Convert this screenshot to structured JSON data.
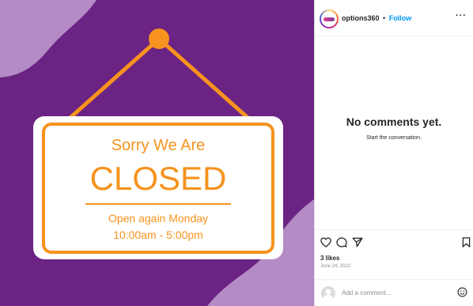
{
  "post": {
    "username": "options360",
    "separator": "•",
    "follow_label": "Follow",
    "more_label": "···"
  },
  "sign": {
    "line1": "Sorry We Are",
    "line2": "CLOSED",
    "line3": "Open again Monday",
    "line4": "10:00am - 5:00pm"
  },
  "comments": {
    "empty_title": "No comments yet.",
    "empty_subtitle": "Start the conversation."
  },
  "engagement": {
    "likes": "3 likes",
    "date": "June 24, 2022"
  },
  "comment_box": {
    "placeholder": "Add a comment..."
  },
  "colors": {
    "background_purple": "#6b2384",
    "blob_lavender": "#b48bc5",
    "sign_orange": "#f7931e",
    "follow_blue": "#0095f6"
  },
  "icons": {
    "like": "heart-icon",
    "comment": "comment-icon",
    "share": "paper-plane-icon",
    "save": "bookmark-icon",
    "emoji": "smiley-icon",
    "more": "ellipsis-icon"
  }
}
